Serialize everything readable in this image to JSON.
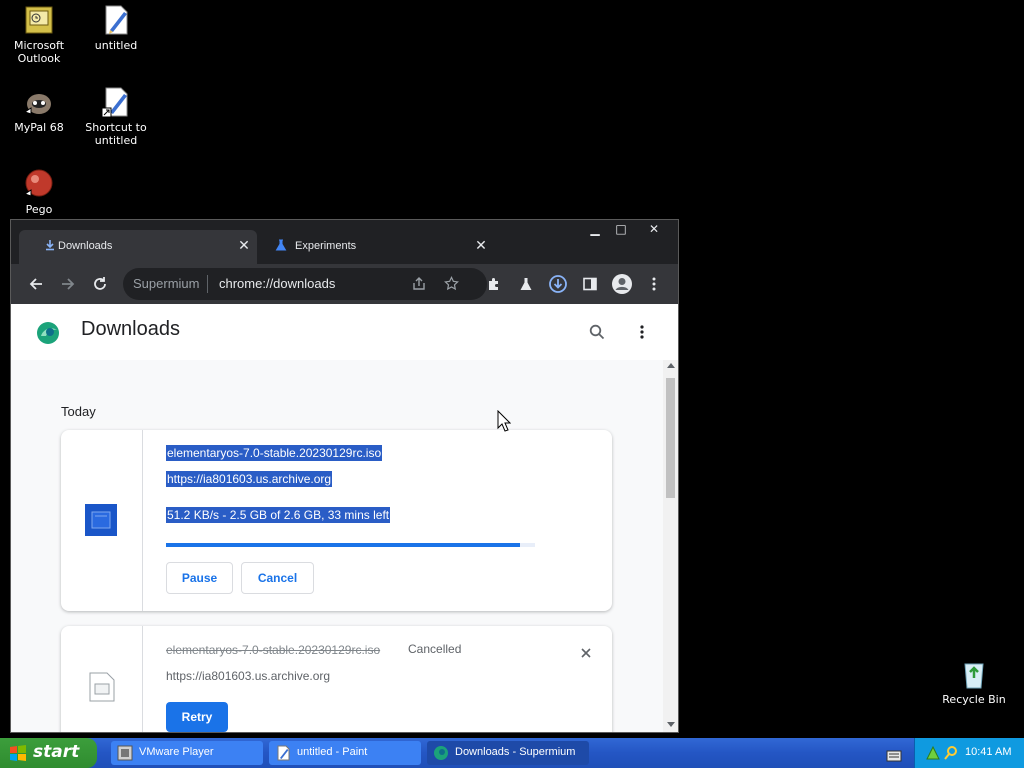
{
  "desktop": {
    "icons": [
      {
        "label": "Microsoft Outlook"
      },
      {
        "label": "untitled"
      },
      {
        "label": "MyPal 68"
      },
      {
        "label": "Shortcut to untitled"
      },
      {
        "label": "Pego"
      },
      {
        "label": "Recycle Bin"
      }
    ]
  },
  "browser": {
    "tabs": [
      {
        "label": "Downloads",
        "active": true
      },
      {
        "label": "Experiments",
        "active": false
      }
    ],
    "window_controls": {
      "minimize": "▁",
      "maximize": "□",
      "close": "✕"
    },
    "omnibox": {
      "site": "Supermium",
      "url": "chrome://downloads"
    },
    "page": {
      "title": "Downloads",
      "section": "Today",
      "downloads": [
        {
          "filename": "elementaryos-7.0-stable.20230129rc.iso",
          "url": "https://ia801603.us.archive.org",
          "status": "51.2 KB/s - 2.5 GB of 2.6 GB, 33 mins left",
          "progress": 0.96,
          "buttons": [
            "Pause",
            "Cancel"
          ]
        },
        {
          "filename": "elementaryos-7.0-stable.20230129rc.iso",
          "state": "Cancelled",
          "url": "https://ia801603.us.archive.org",
          "buttons": [
            "Retry"
          ]
        }
      ]
    }
  },
  "taskbar": {
    "start_label": "start",
    "tasks": [
      {
        "label": "VMware Player",
        "active": false
      },
      {
        "label": "untitled - Paint",
        "active": false
      },
      {
        "label": "Downloads - Supermium",
        "active": true
      }
    ],
    "clock": "10:41 AM"
  },
  "colors": {
    "accent": "#1a73e8",
    "selection": "#2a5dc6",
    "browser_frame": "#202124",
    "taskbar": "#2456c4",
    "start_button": "#3c9e3c"
  }
}
